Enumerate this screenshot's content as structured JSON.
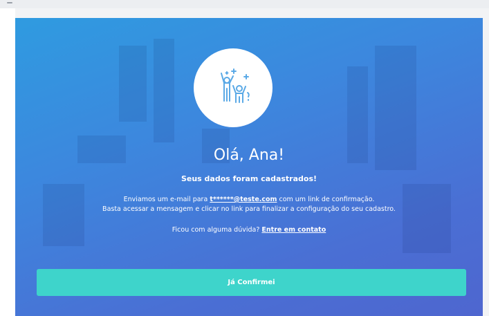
{
  "modal": {
    "title": "Olá, Ana!",
    "subtitle": "Seus dados foram cadastrados!",
    "line1_prefix": "Enviamos um e-mail para ",
    "email": "t******@teste.com",
    "line1_suffix": " com um link de confirmação.",
    "line2": "Basta acessar a mensagem e clicar no link para finalizar a configuração do seu cadastro.",
    "help_prefix": "Ficou com alguma dúvida? ",
    "help_link": "Entre em contato",
    "confirm_button": "Já Confirmei"
  },
  "icons": {
    "hero": "celebrating-people-icon"
  },
  "colors": {
    "gradient_start": "#2f9be0",
    "gradient_end": "#4e66cf",
    "button": "#3ed4cb",
    "icon": "#5aa9e6"
  }
}
